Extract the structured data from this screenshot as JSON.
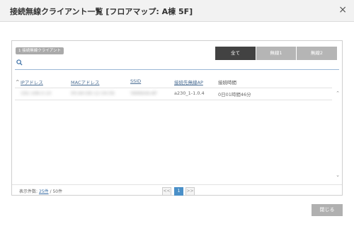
{
  "dialog": {
    "title": "接続無線クライアント一覧 [フロアマップ: A棟 5F]",
    "close_symbol": "×"
  },
  "panel": {
    "badge": "1 接続無線クライアント",
    "tabs": [
      {
        "label": "全て",
        "active": true
      },
      {
        "label": "無線1",
        "active": false
      },
      {
        "label": "無線2",
        "active": false
      }
    ],
    "search": {
      "value": "",
      "placeholder": ""
    },
    "sort_indicator": "^",
    "columns": [
      "IPアドレス",
      "MACアドレス",
      "SSID",
      "接続先無線AP",
      "接続時間"
    ],
    "rows": [
      {
        "ip": "192.168.0.10",
        "mac": "00:A0:DE:12:34:56",
        "ssid": "YAMAHA-AP",
        "ap": "a230_1-1.0.4",
        "time": "0日01時間46分"
      }
    ]
  },
  "footer": {
    "count_label": "表示件数:",
    "count_value": "25件",
    "count_total": "/ 50件",
    "pager": {
      "prev": "<<",
      "current": "1",
      "next": ">>"
    }
  },
  "actions": {
    "close_label": "閉じる"
  },
  "colors": {
    "tab_active": "#424242",
    "tab_inactive": "#b5b5b5",
    "link": "#3a6ea5",
    "close_button": "#b0b0b0"
  }
}
